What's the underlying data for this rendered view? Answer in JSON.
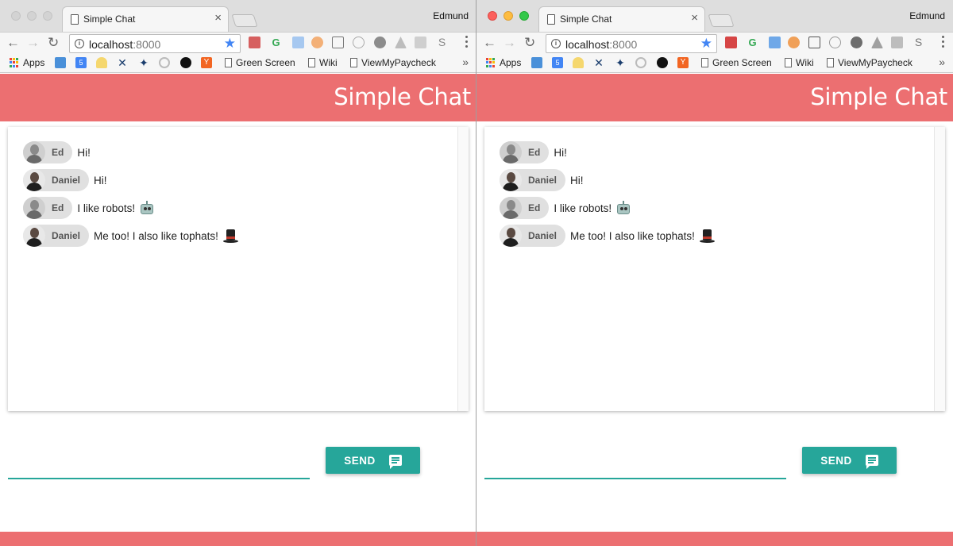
{
  "windows": [
    {
      "id": "left",
      "tab_title": "Simple Chat",
      "tab_close": "×",
      "profile": "Edmund",
      "url_host": "localhost",
      "url_port": ":8000",
      "bookmarks": {
        "apps": "Apps",
        "green_screen": "Green Screen",
        "wiki": "Wiki",
        "viewmypaycheck": "ViewMyPaycheck",
        "more": "»"
      },
      "app_title": "Simple Chat",
      "messages": [
        {
          "name": "Ed",
          "text": "Hi!"
        },
        {
          "name": "Daniel",
          "text": "Hi!"
        },
        {
          "name": "Ed",
          "text": "I like robots!",
          "emoji": "robot"
        },
        {
          "name": "Daniel",
          "text": "Me too! I also like tophats!",
          "emoji": "tophat"
        }
      ],
      "input_value": "",
      "send_label": "SEND"
    },
    {
      "id": "right",
      "tab_title": "Simple Chat",
      "tab_close": "×",
      "profile": "Edmund",
      "url_host": "localhost",
      "url_port": ":8000",
      "bookmarks": {
        "apps": "Apps",
        "green_screen": "Green Screen",
        "wiki": "Wiki",
        "viewmypaycheck": "ViewMyPaycheck",
        "more": "»"
      },
      "app_title": "Simple Chat",
      "messages": [
        {
          "name": "Ed",
          "text": "Hi!"
        },
        {
          "name": "Daniel",
          "text": "Hi!"
        },
        {
          "name": "Ed",
          "text": "I like robots!",
          "emoji": "robot"
        },
        {
          "name": "Daniel",
          "text": "Me too! I also like tophats!",
          "emoji": "tophat"
        }
      ],
      "input_value": "",
      "send_label": "SEND"
    }
  ],
  "colors": {
    "header": "#ec6f71",
    "accent": "#26a69a",
    "chip": "#e0e0e0",
    "star": "#4285f4"
  },
  "icons": {
    "nav_back": "←",
    "nav_forward": "→",
    "nav_reload": "↻",
    "star": "★"
  }
}
